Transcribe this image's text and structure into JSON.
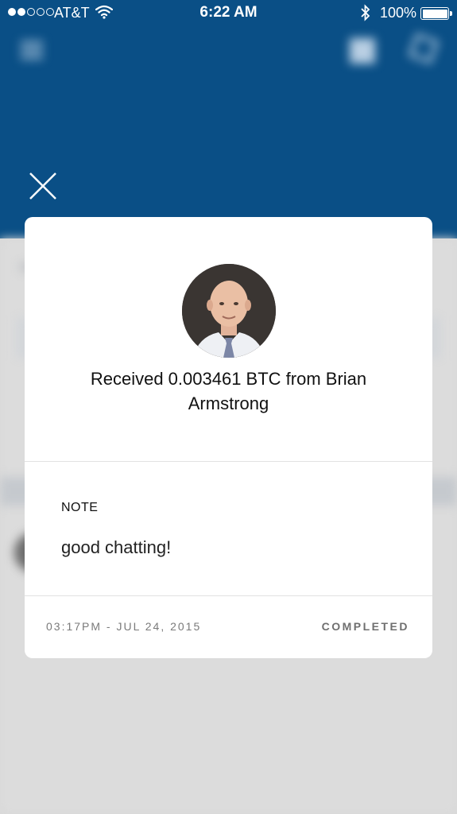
{
  "status_bar": {
    "carrier": "AT&T",
    "time": "6:22 AM",
    "battery": "100%",
    "signal_bars_filled": 2,
    "signal_bars_total": 5
  },
  "background": {
    "header_color": "#0a4f86"
  },
  "close": {
    "icon": "close-icon"
  },
  "transaction": {
    "avatar_icon": "user-avatar",
    "headline": "Received 0.003461 BTC from Brian Armstrong",
    "note_label": "NOTE",
    "note_text": "good chatting!",
    "date": "03:17PM - JUL 24, 2015",
    "status": "COMPLETED"
  }
}
